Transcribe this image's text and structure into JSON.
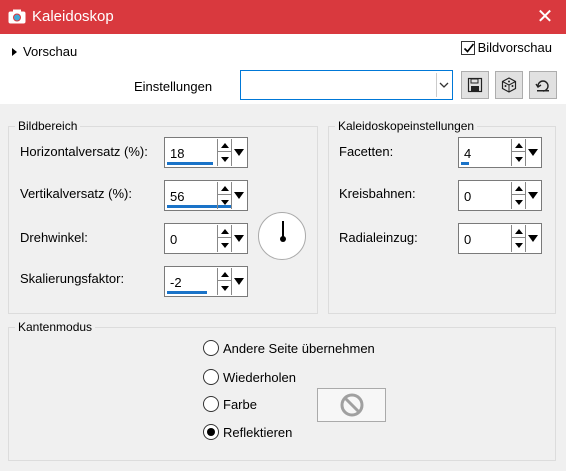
{
  "window": {
    "title": "Kaleidoskop",
    "close_symbol": "✕",
    "accent": "#d9393e"
  },
  "top": {
    "preview_label": "Vorschau",
    "bildvorschau_label": "Bildvorschau",
    "bildvorschau_checked": true,
    "settings_label": "Einstellungen",
    "settings_value": "",
    "buttons": [
      "save-icon",
      "randomize-icon",
      "reset-icon"
    ]
  },
  "bildbereich": {
    "title": "Bildbereich",
    "fields": [
      {
        "label": "Horizontalversatz (%):",
        "value": "18",
        "fill": 0.55
      },
      {
        "label": "Vertikalversatz (%):",
        "value": "56",
        "fill": 0.78
      },
      {
        "label": "Drehwinkel:",
        "value": "0",
        "fill": 0
      },
      {
        "label": "Skalierungsfaktor:",
        "value": "-2",
        "fill": 0.49
      }
    ]
  },
  "kaleido": {
    "title": "Kaleidoskopeinstellungen",
    "fields": [
      {
        "label": "Facetten:",
        "value": "4",
        "fill": 0.12
      },
      {
        "label": "Kreisbahnen:",
        "value": "0",
        "fill": 0
      },
      {
        "label": "Radialeinzug:",
        "value": "0",
        "fill": 0
      }
    ]
  },
  "kantenmodus": {
    "title": "Kantenmodus",
    "options": [
      {
        "label": "Andere Seite übernehmen",
        "selected": false
      },
      {
        "label": "Wiederholen",
        "selected": false
      },
      {
        "label": "Farbe",
        "selected": false
      },
      {
        "label": "Reflektieren",
        "selected": true
      }
    ]
  }
}
